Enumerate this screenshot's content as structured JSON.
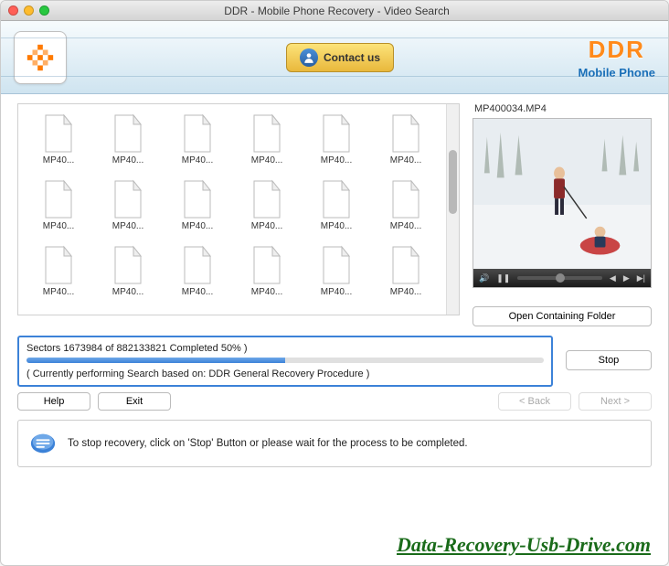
{
  "window": {
    "title": "DDR - Mobile Phone Recovery - Video Search"
  },
  "header": {
    "contact_label": "Contact us",
    "brand_main": "DDR",
    "brand_sub": "Mobile Phone"
  },
  "files": [
    {
      "label": "MP40..."
    },
    {
      "label": "MP40..."
    },
    {
      "label": "MP40..."
    },
    {
      "label": "MP40..."
    },
    {
      "label": "MP40..."
    },
    {
      "label": "MP40..."
    },
    {
      "label": "MP40..."
    },
    {
      "label": "MP40..."
    },
    {
      "label": "MP40..."
    },
    {
      "label": "MP40..."
    },
    {
      "label": "MP40..."
    },
    {
      "label": "MP40..."
    },
    {
      "label": "MP40..."
    },
    {
      "label": "MP40..."
    },
    {
      "label": "MP40..."
    },
    {
      "label": "MP40..."
    },
    {
      "label": "MP40..."
    },
    {
      "label": "MP40..."
    }
  ],
  "preview": {
    "filename": "MP400034.MP4",
    "open_folder_label": "Open Containing Folder"
  },
  "progress": {
    "status_text": "Sectors 1673984 of   882133821   Completed 50% )",
    "percent": 50,
    "sub_text": "( Currently performing Search based on: DDR General Recovery Procedure )",
    "stop_label": "Stop"
  },
  "nav": {
    "help": "Help",
    "exit": "Exit",
    "back": "< Back",
    "next": "Next >"
  },
  "hint": {
    "text": "To stop recovery, click on 'Stop' Button or please wait for the process to be completed."
  },
  "watermark": "Data-Recovery-Usb-Drive.com"
}
